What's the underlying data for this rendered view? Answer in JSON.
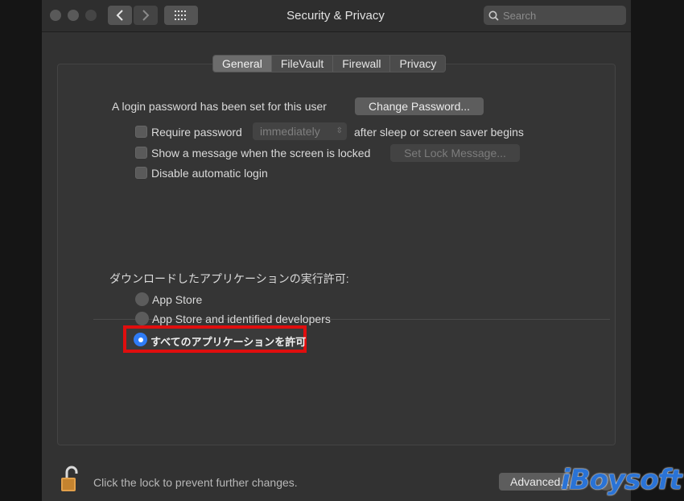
{
  "window": {
    "title": "Security & Privacy",
    "search_placeholder": "Search"
  },
  "tabs": [
    "General",
    "FileVault",
    "Firewall",
    "Privacy"
  ],
  "active_tab": "General",
  "general": {
    "login_password_text": "A login password has been set for this user",
    "change_password_label": "Change Password...",
    "require_password": {
      "label": "Require password",
      "checked": false,
      "select_value": "immediately",
      "suffix": "after sleep or screen saver begins"
    },
    "show_message": {
      "label": "Show a message when the screen is locked",
      "checked": false,
      "button_label": "Set Lock Message..."
    },
    "disable_auto_login": {
      "label": "Disable automatic login",
      "checked": false
    }
  },
  "downloads": {
    "heading": "ダウンロードしたアプリケーションの実行許可:",
    "options": [
      "App Store",
      "App Store and identified developers",
      "すべてのアプリケーションを許可"
    ],
    "selected_index": 2
  },
  "footer": {
    "lock_text": "Click the lock to prevent further changes.",
    "advanced_label": "Advanced...",
    "help_label": "?"
  },
  "watermark": "iBoysoft",
  "colors": {
    "highlight": "#e00e0e",
    "radio_selected": "#2f7cf6",
    "lock": "#e2a04a"
  },
  "icons": [
    "back-chevron-icon",
    "forward-chevron-icon",
    "grid-icon",
    "search-icon",
    "lock-icon"
  ]
}
